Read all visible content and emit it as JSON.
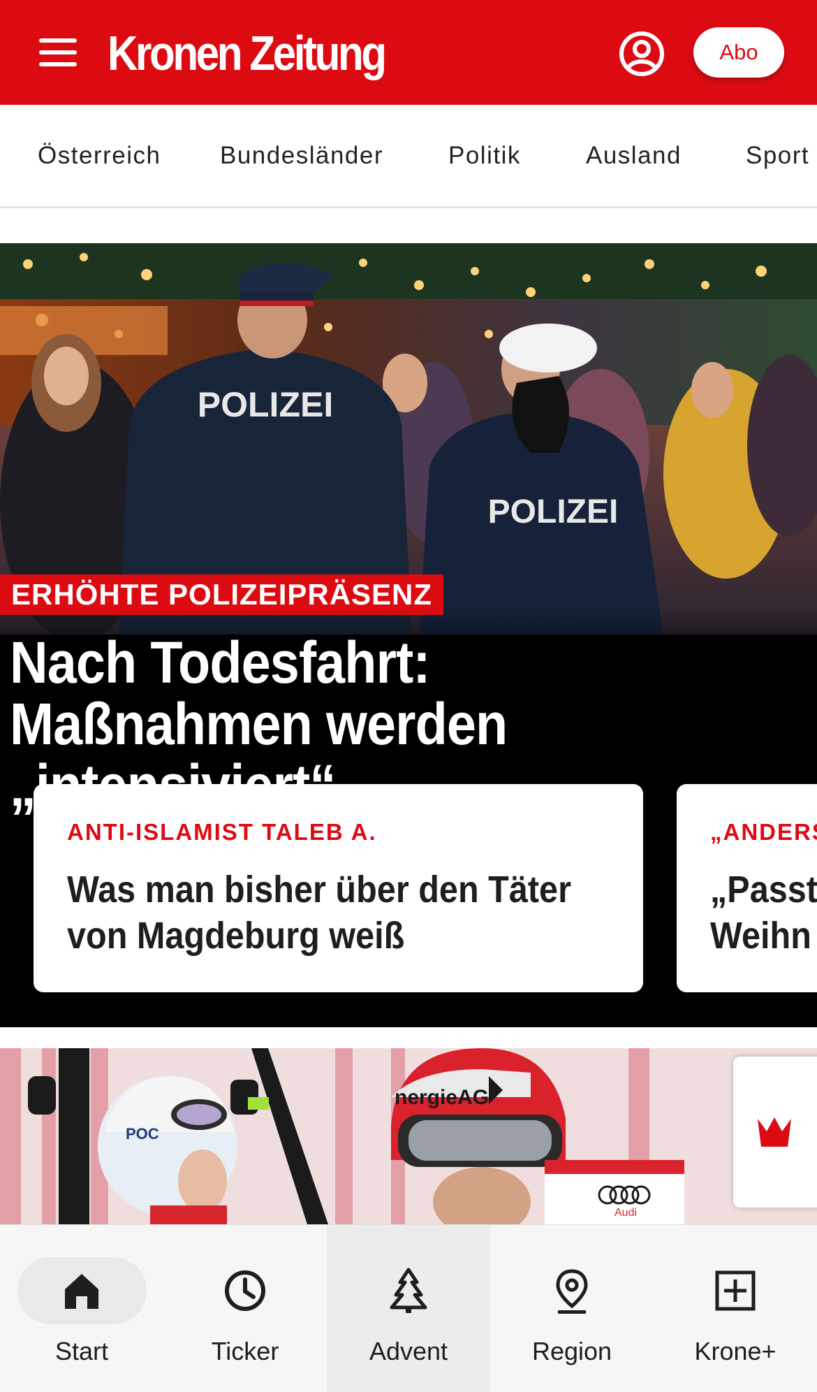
{
  "header": {
    "logo_text": "Kronen Zeitung",
    "abo_label": "Abo",
    "brand_color": "#dc0b12"
  },
  "section_nav": {
    "items": [
      {
        "label": "Österreich"
      },
      {
        "label": "Bundesländer"
      },
      {
        "label": "Politik"
      },
      {
        "label": "Ausland"
      },
      {
        "label": "Sport"
      }
    ]
  },
  "hero": {
    "image_text_1": "POLIZEI",
    "image_text_2": "POLIZEI",
    "kicker": "ERHÖHTE POLIZEIPRÄSENZ",
    "title": "Nach Todesfahrt: Maßnahmen werden „intensiviert“"
  },
  "cards": [
    {
      "kicker": "ANTI-ISLAMIST TALEB A.",
      "title_line1": "Was man bisher über den Täter",
      "title_line2": "von Magdeburg weiß"
    },
    {
      "kicker": "„ANDERS",
      "title_line1": "„Passt",
      "title_line2": "Weihn"
    }
  ],
  "teaser2": {
    "image_text_1": "nergieAG",
    "image_text_2": "POC",
    "image_text_3": "Audi"
  },
  "bottom_nav": {
    "items": [
      {
        "label": "Start",
        "icon": "home-icon"
      },
      {
        "label": "Ticker",
        "icon": "clock-icon"
      },
      {
        "label": "Advent",
        "icon": "tree-icon"
      },
      {
        "label": "Region",
        "icon": "location-pin-icon"
      },
      {
        "label": "Krone+",
        "icon": "plus-square-icon"
      }
    ]
  }
}
